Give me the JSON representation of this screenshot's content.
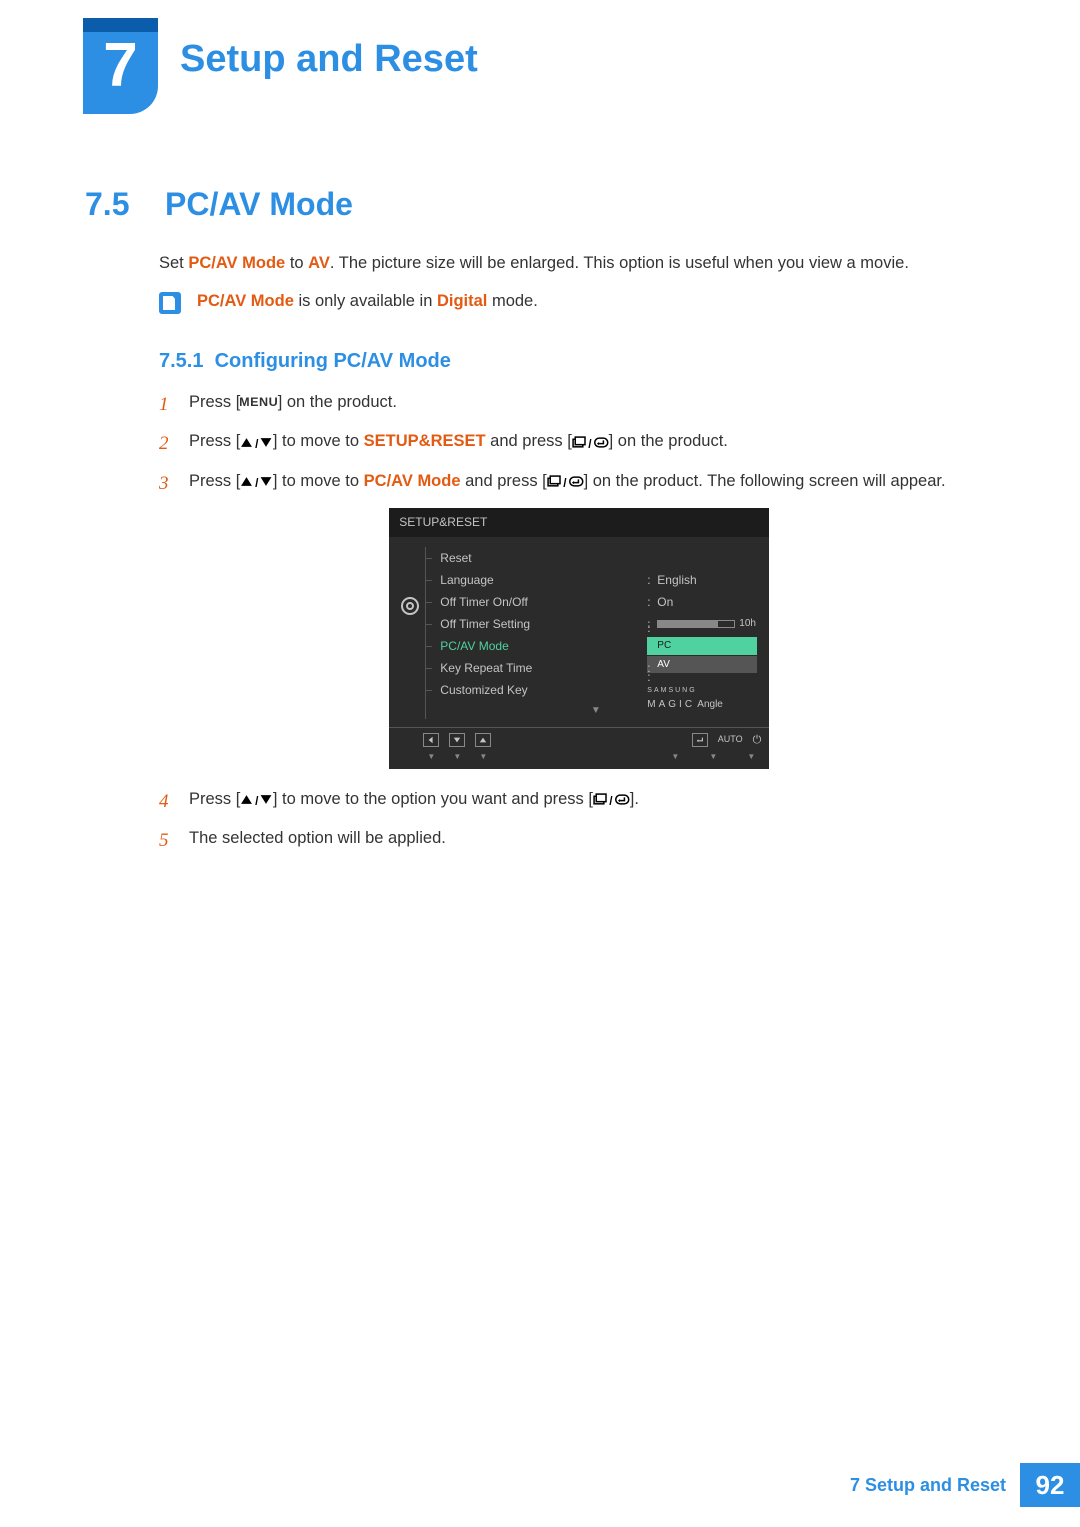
{
  "chapter": {
    "number": "7",
    "title": "Setup and Reset"
  },
  "section": {
    "number": "7.5",
    "title": "PC/AV Mode"
  },
  "intro": {
    "prefix": "Set ",
    "bold1": "PC/AV Mode",
    "mid1": " to ",
    "bold2": "AV",
    "rest": ". The picture size will be enlarged. This option is useful when you view a movie."
  },
  "note": {
    "bold1": "PC/AV Mode",
    "mid": " is only available in ",
    "bold2": "Digital",
    "rest": " mode."
  },
  "subsection": {
    "number": "7.5.1",
    "title": "Configuring PC/AV Mode"
  },
  "steps": {
    "s1": {
      "n": "1",
      "a": "Press [",
      "menu": "MENU",
      "b": "] on the product."
    },
    "s2": {
      "n": "2",
      "a": "Press [",
      "b": "] to move to ",
      "target": "SETUP&RESET",
      "c": " and press [",
      "d": "] on the product."
    },
    "s3": {
      "n": "3",
      "a": "Press [",
      "b": "] to move to ",
      "target": "PC/AV Mode",
      "c": " and press [",
      "d": "] on the product. The following screen will appear."
    },
    "s4": {
      "n": "4",
      "a": "Press [",
      "b": "] to move to the option you want and press [",
      "c": "]."
    },
    "s5": {
      "n": "5",
      "a": "The selected option will be applied."
    }
  },
  "osd": {
    "header": "SETUP&RESET",
    "rows": {
      "reset": "Reset",
      "language": {
        "label": "Language",
        "value": "English"
      },
      "offtimer": {
        "label": "Off Timer On/Off",
        "value": "On"
      },
      "offtimerset": {
        "label": "Off Timer Setting",
        "value": "10h"
      },
      "pcav": {
        "label": "PC/AV Mode",
        "opt1": "PC",
        "opt2": "AV"
      },
      "keyrepeat": {
        "label": "Key Repeat Time"
      },
      "customkey": {
        "label": "Customized Key",
        "magic1": "SAMSUNG",
        "magic2": "MAGIC",
        "angle": "Angle"
      }
    },
    "footer": {
      "auto": "AUTO"
    }
  },
  "footer": {
    "text": "7 Setup and Reset",
    "page": "92"
  }
}
